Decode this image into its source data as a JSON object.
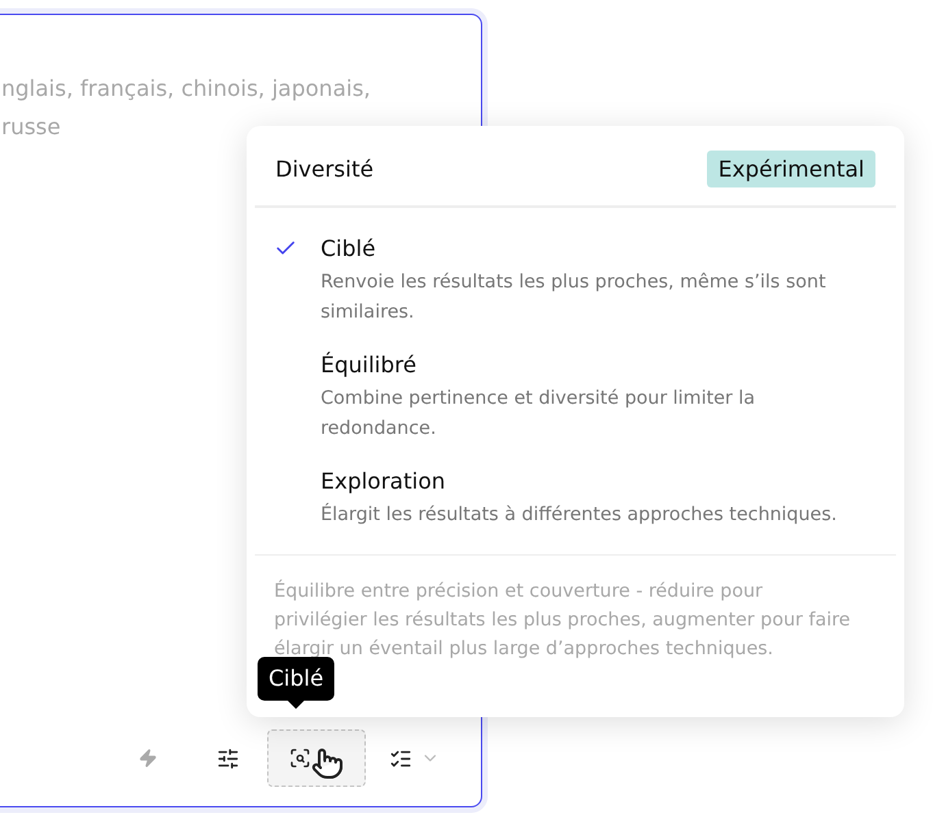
{
  "editor": {
    "placeholder_lines": [
      "nglais, français, chinois, japonais,",
      "russe"
    ]
  },
  "popover": {
    "title": "Diversité",
    "badge": "Expérimental",
    "options": [
      {
        "label": "Ciblé",
        "description": "Renvoie les résultats les plus proches, même s’ils sont similaires.",
        "selected": true
      },
      {
        "label": "Équilibré",
        "description": "Combine pertinence et diversité pour limiter la redondance.",
        "selected": false
      },
      {
        "label": "Exploration",
        "description": "Élargit les résultats à différentes approches techniques.",
        "selected": false
      }
    ],
    "footnote": "Équilibre entre précision et couverture - réduire pour privilégier les résultats les plus proches, augmenter pour faire élargir un éventail plus large d’approches techniques."
  },
  "tooltip": "Ciblé"
}
